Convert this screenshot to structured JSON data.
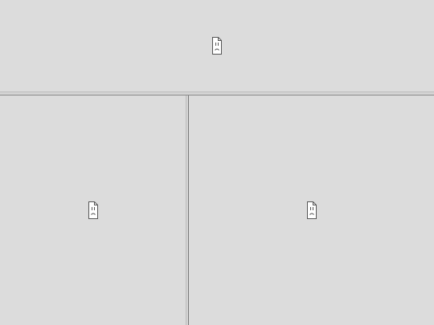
{
  "frames": [
    {
      "id": "top",
      "icon": "sad-document-icon"
    },
    {
      "id": "bottom-left",
      "icon": "sad-document-icon"
    },
    {
      "id": "bottom-right",
      "icon": "sad-document-icon"
    }
  ],
  "colors": {
    "background": "#dcdcdc",
    "icon_stroke": "#555555",
    "divider_dark": "#8a8a8a"
  }
}
